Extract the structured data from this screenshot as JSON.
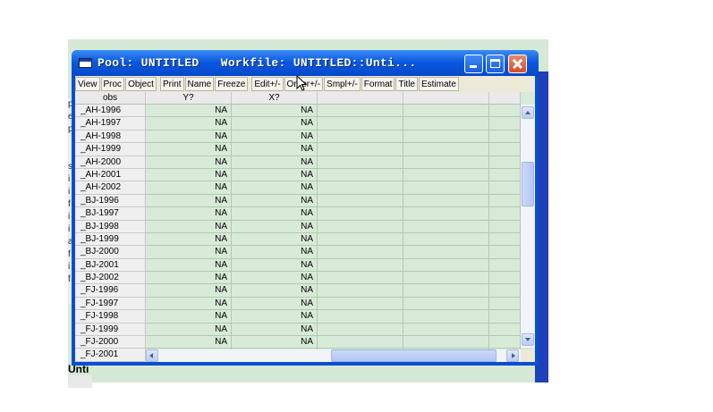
{
  "window": {
    "title": "Pool: UNTITLED   Workfile: UNTITLED::Unti..."
  },
  "toolbar": [
    "View",
    "Proc",
    "Object",
    "Print",
    "Name",
    "Freeze",
    "Edit+/-",
    "Order+/-",
    "Smpl+/-",
    "Format",
    "Title",
    "Estimate"
  ],
  "columns": {
    "obs": "obs",
    "y": "Y?",
    "x": "X?"
  },
  "rows": [
    {
      "obs": "_AH-1996",
      "y": "NA",
      "x": "NA"
    },
    {
      "obs": "_AH-1997",
      "y": "NA",
      "x": "NA"
    },
    {
      "obs": "_AH-1998",
      "y": "NA",
      "x": "NA"
    },
    {
      "obs": "_AH-1999",
      "y": "NA",
      "x": "NA"
    },
    {
      "obs": "_AH-2000",
      "y": "NA",
      "x": "NA"
    },
    {
      "obs": "_AH-2001",
      "y": "NA",
      "x": "NA"
    },
    {
      "obs": "_AH-2002",
      "y": "NA",
      "x": "NA"
    },
    {
      "obs": "_BJ-1996",
      "y": "NA",
      "x": "NA"
    },
    {
      "obs": "_BJ-1997",
      "y": "NA",
      "x": "NA"
    },
    {
      "obs": "_BJ-1998",
      "y": "NA",
      "x": "NA"
    },
    {
      "obs": "_BJ-1999",
      "y": "NA",
      "x": "NA"
    },
    {
      "obs": "_BJ-2000",
      "y": "NA",
      "x": "NA"
    },
    {
      "obs": "_BJ-2001",
      "y": "NA",
      "x": "NA"
    },
    {
      "obs": "_BJ-2002",
      "y": "NA",
      "x": "NA"
    },
    {
      "obs": "_FJ-1996",
      "y": "NA",
      "x": "NA"
    },
    {
      "obs": "_FJ-1997",
      "y": "NA",
      "x": "NA"
    },
    {
      "obs": "_FJ-1998",
      "y": "NA",
      "x": "NA"
    },
    {
      "obs": "_FJ-1999",
      "y": "NA",
      "x": "NA"
    },
    {
      "obs": "_FJ-2000",
      "y": "NA",
      "x": "NA"
    },
    {
      "obs": "_FJ-2001",
      "y": "",
      "x": ""
    }
  ],
  "background": {
    "bottom_label": "Unti",
    "left_strip_chars": [
      "p",
      "e",
      "p",
      "",
      "",
      "s",
      "i",
      "i",
      "f",
      "i",
      "i",
      "a",
      "f",
      "i",
      "f"
    ]
  },
  "colors": {
    "titlebar": "#0a58e0",
    "cell_background": "#d8ead8",
    "toolbar": "#ece9d8",
    "close_button": "#d24e25"
  },
  "icons": {
    "window": "window-icon",
    "minimize": "minimize-icon",
    "maximize": "maximize-icon",
    "close": "close-icon",
    "scroll_up": "chevron-up-icon",
    "scroll_down": "chevron-down-icon",
    "scroll_left": "chevron-left-icon",
    "scroll_right": "chevron-right-icon",
    "cursor": "mouse-cursor-icon",
    "grip": "size-grip-icon"
  }
}
